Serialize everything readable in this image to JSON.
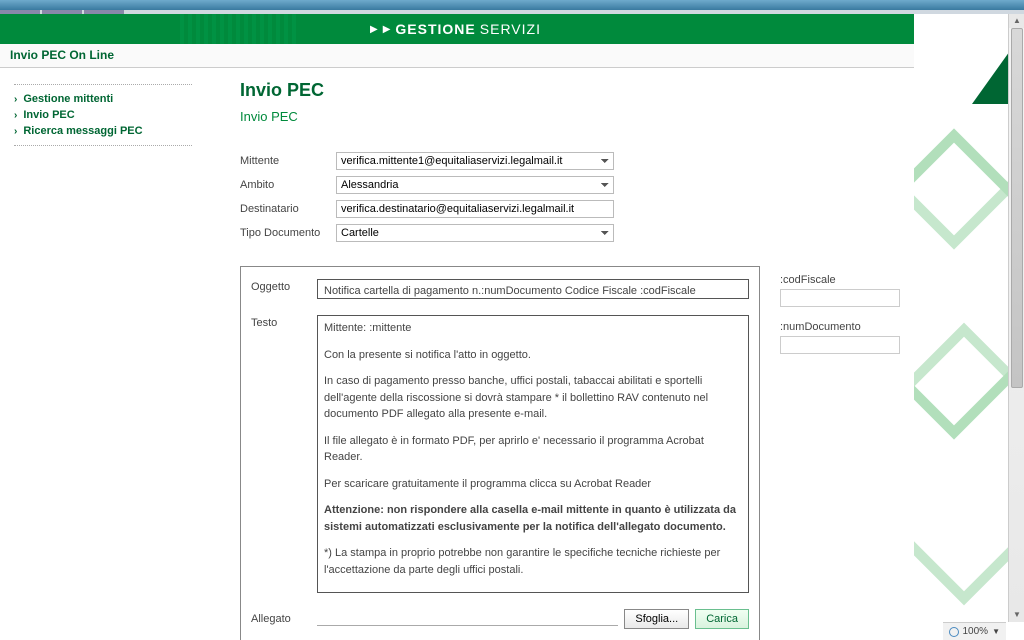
{
  "header": {
    "brand1": "GESTIONE",
    "brand2": "SERVIZI"
  },
  "subbar": {
    "title": "Invio PEC On Line"
  },
  "sidebar": {
    "items": [
      {
        "label": "Gestione mittenti"
      },
      {
        "label": "Invio PEC"
      },
      {
        "label": "Ricerca messaggi PEC"
      }
    ]
  },
  "page": {
    "title": "Invio PEC",
    "subtitle": "Invio PEC"
  },
  "form": {
    "mittente_label": "Mittente",
    "mittente_value": "verifica.mittente1@equitaliaservizi.legalmail.it",
    "ambito_label": "Ambito",
    "ambito_value": "Alessandria",
    "destinatario_label": "Destinatario",
    "destinatario_value": "verifica.destinatario@equitaliaservizi.legalmail.it",
    "tipodoc_label": "Tipo Documento",
    "tipodoc_value": "Cartelle"
  },
  "panel": {
    "oggetto_label": "Oggetto",
    "oggetto_value": "Notifica cartella di pagamento n.:numDocumento Codice Fiscale :codFiscale",
    "testo_label": "Testo",
    "testo": {
      "l1": "Mittente: :mittente",
      "l2": "Con la presente si notifica l'atto in oggetto.",
      "l3": "In caso di pagamento presso banche, uffici postali, tabaccai abilitati e sportelli dell'agente della riscossione si dovrà stampare * il bollettino RAV contenuto nel documento PDF allegato alla presente e-mail.",
      "l4": "Il file allegato è in formato PDF, per aprirlo e' necessario il programma Acrobat Reader.",
      "l5": "Per scaricare gratuitamente il programma clicca su Acrobat Reader",
      "l6": "Attenzione: non rispondere alla casella e-mail mittente in quanto è utilizzata da sistemi automatizzati esclusivamente per la notifica dell'allegato documento.",
      "l7": "*) La stampa in proprio potrebbe non garantire le specifiche tecniche richieste per l'accettazione da parte degli uffici postali."
    },
    "allegato_label": "Allegato",
    "sfoglia_label": "Sfoglia...",
    "carica_label": "Carica"
  },
  "side_fields": {
    "codfiscale_label": ":codFiscale",
    "numdoc_label": ":numDocumento"
  },
  "status": {
    "zoom": "100%"
  }
}
